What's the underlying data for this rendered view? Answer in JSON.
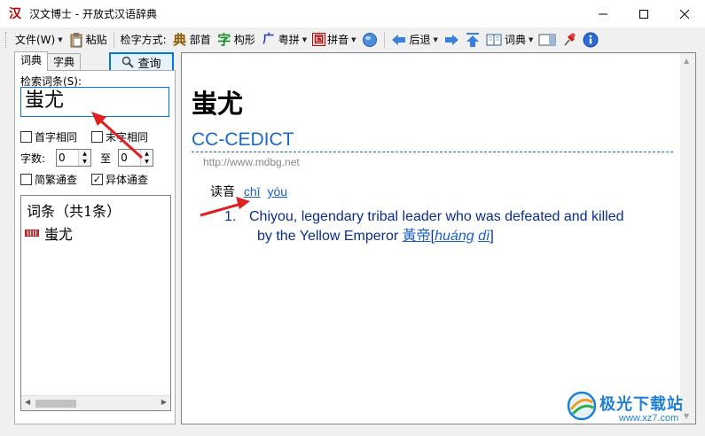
{
  "window": {
    "title": "汉文博士 - 开放式汉语辞典",
    "app_icon": "汉"
  },
  "toolbar": {
    "file_menu": "文件(W)",
    "paste": "粘贴",
    "lookup_mode_label": "检字方式:",
    "radical": "部首",
    "shape": "构形",
    "cantonese": "粤拼",
    "pinyin": "拼音",
    "back": "后退",
    "dictionary": "词典",
    "icons": {
      "radical": "典",
      "shape": "字",
      "cantonese": "广",
      "pinyin": "国"
    }
  },
  "left": {
    "tabs": [
      "词典",
      "字典"
    ],
    "query_button": "查询",
    "search_label": "检索词条(S):",
    "search_value": "蚩尤",
    "options": {
      "first_char_same": "首字相同",
      "last_char_same": "末字相同",
      "char_count_label": "字数:",
      "char_count_from": "0",
      "to_label": "至",
      "char_count_to": "0",
      "simp_trad": "简繁通查",
      "variant": "异体通查"
    },
    "results_header": "词条（共1条）",
    "results": [
      "蚩尤"
    ]
  },
  "content": {
    "headword": "蚩尤",
    "dict_name": "CC-CEDICT",
    "dict_url": "http://www.mdbg.net",
    "reading_label": "读音",
    "reading_syllables": [
      "chī",
      "yóu"
    ],
    "definition_number": "1.",
    "definition_line1": "Chiyou, legendary tribal leader who was defeated and killed",
    "definition_line2": "by the Yellow Emperor",
    "xref_word": "黃帝",
    "xref_pinyin1": "huáng",
    "xref_pinyin2": "dì"
  },
  "watermark": {
    "text": "极光下载站",
    "url": "www.xz7.com"
  },
  "colors": {
    "accent": "#0078d7",
    "link": "#1b5fc6",
    "definition": "#0b2e8c",
    "dict_title": "#1b6ac9",
    "arrow": "#e02020"
  }
}
